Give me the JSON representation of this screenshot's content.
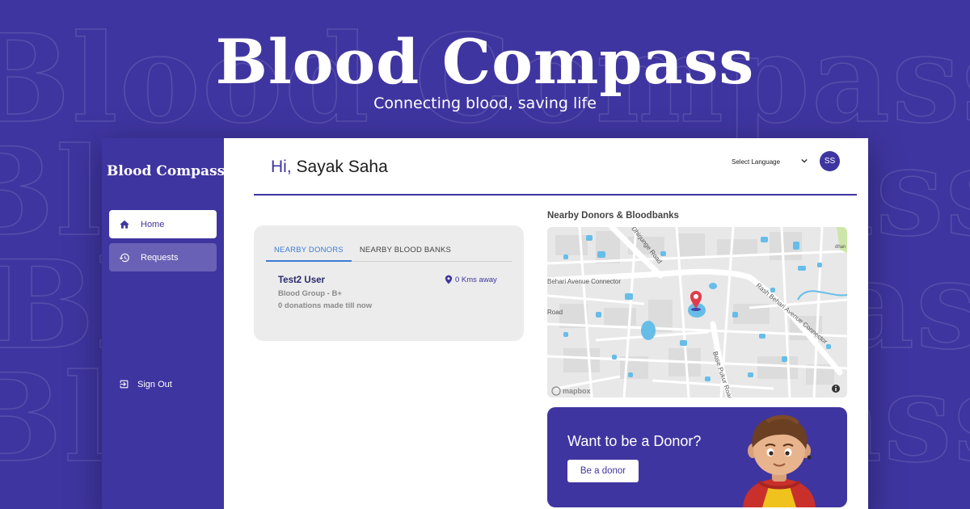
{
  "hero": {
    "title": "Blood Compass",
    "tagline": "Connecting blood, saving life"
  },
  "sidebar": {
    "logo": "Blood Compass",
    "items": [
      {
        "label": "Home",
        "icon": "home-icon",
        "active": true
      },
      {
        "label": "Requests",
        "icon": "history-icon",
        "active": false
      }
    ],
    "sign_out": "Sign Out"
  },
  "header": {
    "greeting_prefix": "Hi,",
    "user_name": "Sayak Saha",
    "language_select": "Select Language",
    "avatar_initials": "SS"
  },
  "donors_card": {
    "tabs": [
      "NEARBY DONORS",
      "NEARBY BLOOD BANKS"
    ],
    "active_tab": 0,
    "donors": [
      {
        "name": "Test2 User",
        "blood_group": "Blood Group - B+",
        "donations": "0 donations made till now",
        "distance": "0 Kms away"
      }
    ]
  },
  "map": {
    "title": "Nearby Donors & Bloodbanks",
    "road_labels": [
      "Behari Avenue Connector",
      "Rash Behari Avenue Connector",
      "Dhirjunge Road",
      "Bose Pukur Road",
      "Road",
      "dhan"
    ],
    "attribution": "mapbox",
    "info_icon": "info-icon",
    "marker_icon": "map-pin-icon"
  },
  "banner": {
    "title": "Want to be a Donor?",
    "button_label": "Be a donor"
  },
  "colors": {
    "brand": "#3f35a0",
    "tab_active": "#3d7bd6",
    "card_bg": "#ececec",
    "map_water": "#66bde8",
    "map_pin": "#e23b4a"
  }
}
